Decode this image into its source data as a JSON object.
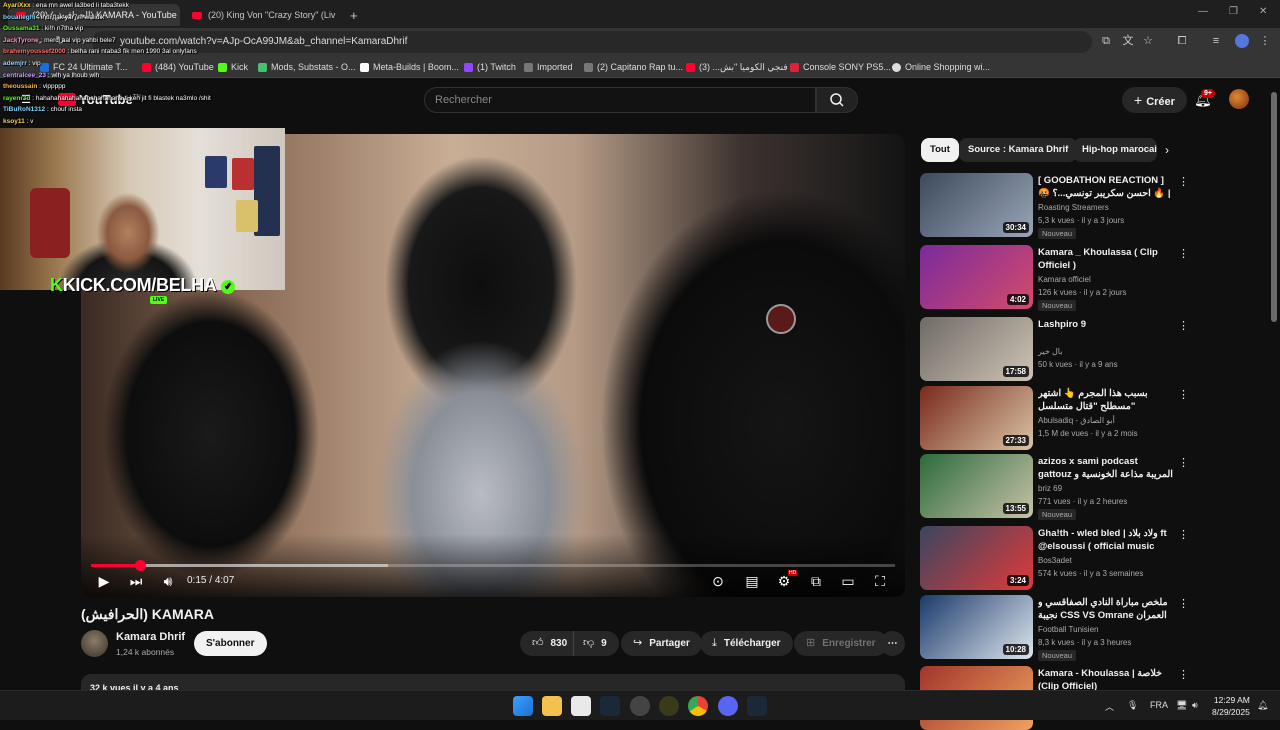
{
  "browser": {
    "tabs": [
      {
        "label": "(20) (الحرافيش) KAMARA - YouTube"
      },
      {
        "label": "(20) King Von \"Crazy Story\" (Liv"
      }
    ],
    "new_tab": "+",
    "address": "youtube.com/watch?v=AJp-OcA99JM&ab_channel=KamaraDhrif",
    "bookmarks": [
      {
        "label": "FC 24 Ultimate T...",
        "color": "#1e6ed8"
      },
      {
        "label": "(484) YouTube",
        "color": "#ff0033"
      },
      {
        "label": "Kick",
        "color": "#53fc18"
      },
      {
        "label": "Mods, Substats - O...",
        "color": "#47c16e"
      },
      {
        "label": "Meta-Builds | Boom...",
        "color": "#ffffff"
      },
      {
        "label": "(1) Twitch",
        "color": "#9146ff"
      },
      {
        "label": "Imported",
        "color": "#777777"
      },
      {
        "label": "(2) Capitano Rap tu...",
        "color": "#777777"
      },
      {
        "label": "فنجي الكوميا \"بش... (3)",
        "color": "#ff0033"
      },
      {
        "label": "Console SONY PS5...",
        "color": "#e0213c"
      },
      {
        "label": "Online Shopping wi...",
        "color": "#dddddd"
      }
    ]
  },
  "youtube": {
    "logo": "YouTube",
    "logo_suffix": "TN",
    "search_placeholder": "Rechercher",
    "create_label": "Créer",
    "notif_count": "9+"
  },
  "chat": [
    {
      "user": "AyariXxx",
      "text": "ena mn awel la3bed li taba3tekk",
      "color": "#ffd23f"
    },
    {
      "user": "boualleghi",
      "text": "ihdi flak yar7m walidik",
      "color": "#7ad7ff"
    },
    {
      "user": "Oussama31",
      "text": "ki!h n7tha vip",
      "color": "#53fc18"
    },
    {
      "user": "JackTyrone",
      "text": "merci aal vip yahbi bele7",
      "color": "#ff8fc7"
    },
    {
      "user": "brahemyoussef2000",
      "text": "belha rani ntaba3 fik men 1990 3al onlyfans",
      "color": "#ff6b6b"
    },
    {
      "user": "ademjrr",
      "text": "vip",
      "color": "#9ad0ff"
    },
    {
      "user": "centralcee_23",
      "text": "wlh ya lhoub wlh",
      "color": "#c49bff"
    },
    {
      "user": "theoussain",
      "text": "vippppp",
      "color": "#ffb347"
    },
    {
      "user": "rayenr3d",
      "text": "hahahahahahahahahahahaha ti ken jit fi blastek na3mlo /shit",
      "color": "#53fc18"
    },
    {
      "user": "TiBuRoN1312",
      "text": "chouf insta",
      "color": "#7ad7ff"
    },
    {
      "user": "ksoy11",
      "text": "v",
      "color": "#ffd23f"
    }
  ],
  "overlay": {
    "kick_prefix": "K",
    "kick_text": "KICK.COM/BELHA",
    "live": "LIVE"
  },
  "player": {
    "time_current": "0:15",
    "time_total": "4:07",
    "progress": 0.061,
    "buffered": 0.37,
    "settings_badge": "HD"
  },
  "video": {
    "title": "(الحرافيش) KAMARA",
    "channel": "Kamara Dhrif",
    "subscribers": "1,24 k abonnés",
    "subscribe_label": "S'abonner",
    "likes": "830",
    "dislikes": "9",
    "share_label": "Partager",
    "download_label": "Télécharger",
    "save_label": "Enregistrer",
    "description_head": "32 k vues  il y a 4 ans"
  },
  "chips": [
    {
      "label": "Tout",
      "active": true
    },
    {
      "label": "Source : Kamara Dhrif",
      "active": false
    },
    {
      "label": "Hip-hop marocain",
      "active": false
    }
  ],
  "recommendations": [
    {
      "title": "[ GOOBATHON REACTION ] 🤬 احسن سكريبر تونسي...؟ 🔥 | Letaief -...",
      "channel": "Roasting Streamers",
      "meta": "5,3 k vues · il y a 3 jours",
      "duration": "30:34",
      "badge": "Nouveau",
      "thumb": [
        "#3d4a5c",
        "#9aa6b8"
      ]
    },
    {
      "title": "Kamara _ Khoulassa ( Clip Officiel )",
      "channel": "Kamara officiel",
      "meta": "126 k vues · il y a 2 jours",
      "duration": "4:02",
      "badge": "Nouveau",
      "thumb": [
        "#7a2a9c",
        "#d44b6b"
      ]
    },
    {
      "title": "Lashpiro 9",
      "channel": "بال خير",
      "meta": "50 k vues · il y a 9 ans",
      "duration": "17:58",
      "badge": "",
      "thumb": [
        "#6f6a66",
        "#cfc5b6"
      ]
    },
    {
      "title": "بسبب هذا المجرم 👆 اشتهر مسطلح \"قتال متسلسل\"",
      "channel": "Abulsadiq - أبو الصادق",
      "meta": "1,5 M de vues · il y a 2 mois",
      "duration": "27:33",
      "badge": "",
      "thumb": [
        "#7a2a1c",
        "#d9c4a5"
      ]
    },
    {
      "title": "azizos x sami podcast gattouz المريبة مذاعة الخونسية و لات مفهومة في ...",
      "channel": "briz 69",
      "meta": "771 vues · il y a 2 heures",
      "duration": "13:55",
      "badge": "Nouveau",
      "thumb": [
        "#2c6b3a",
        "#c7c2a8"
      ]
    },
    {
      "title": "Gha!th - wled bled | ولاد بلاد ft @elsoussi ( official music vid...",
      "channel": "Bos3adet",
      "meta": "574 k vues · il y a 3 semaines",
      "duration": "3:24",
      "badge": "",
      "thumb": [
        "#3a4660",
        "#e03a3a"
      ]
    },
    {
      "title": "ملخص مباراة النادي الصفاقسي و نجيبة CSS VS Omrane العمران",
      "channel": "Football Tunisien",
      "meta": "8,3 k vues · il y a 3 heures",
      "duration": "10:28",
      "badge": "Nouveau",
      "thumb": [
        "#1a3a6a",
        "#dfe6ee"
      ]
    },
    {
      "title": "Kamara - Khoulassa | خلاصة (Clip Officiel)",
      "channel": "",
      "meta": "",
      "duration": "",
      "badge": "",
      "thumb": [
        "#a0352a",
        "#f0a060"
      ]
    }
  ],
  "taskbar": {
    "lang": "FRA",
    "time": "12:29 AM",
    "date": "8/29/2025"
  }
}
